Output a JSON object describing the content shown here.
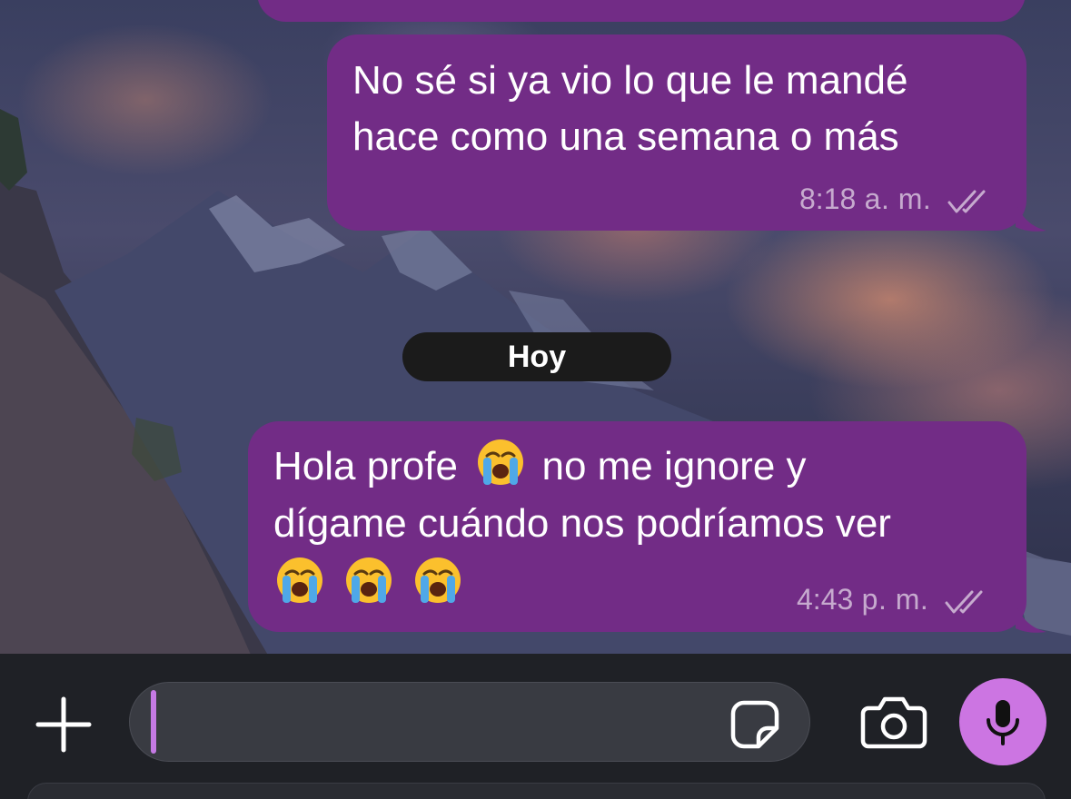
{
  "colors": {
    "bubble": "#722c86",
    "accent": "#cc75e2",
    "date_pill": "#1b1b1b",
    "composer": "#1f2126"
  },
  "messages": [
    {
      "lines": [
        "No sé si ya vio lo que le mandé",
        "hace como una semana o más"
      ],
      "time": "8:18",
      "period": "a. m.",
      "status_icon": "double-check-icon"
    },
    {
      "lines": [
        "Hola profe",
        "no me ignore y",
        "dígame cuándo nos podríamos ver"
      ],
      "emoji": "loudly-crying-face-emoji",
      "time": "4:43",
      "period": "p. m.",
      "status_icon": "double-check-icon"
    }
  ],
  "date_separator": "Hoy",
  "composer": {
    "icons": [
      "plus-icon",
      "sticker-icon",
      "camera-icon",
      "microphone-icon"
    ]
  }
}
